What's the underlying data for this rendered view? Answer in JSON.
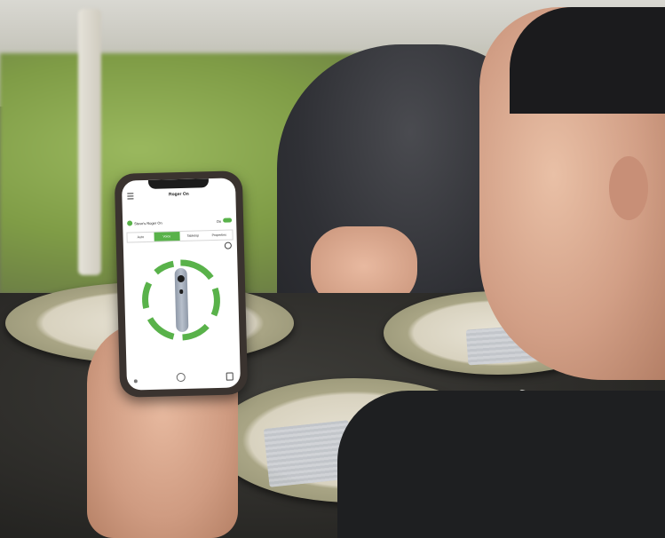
{
  "app": {
    "title": "Roger On",
    "device_name": "Steve's Roger On",
    "toggle_label": "On",
    "tabs": [
      {
        "label": "Auto",
        "active": false
      },
      {
        "label": "Voice",
        "active": true
      },
      {
        "label": "Tabletop",
        "active": false
      },
      {
        "label": "Properties",
        "active": false
      }
    ]
  },
  "colors": {
    "accent": "#59b24a",
    "ring_segment": "#59b24a",
    "device_body": "#9aa3b0"
  },
  "icons": {
    "menu": "menu-icon",
    "info": "info-icon",
    "home": "home-icon",
    "save": "save-icon"
  }
}
